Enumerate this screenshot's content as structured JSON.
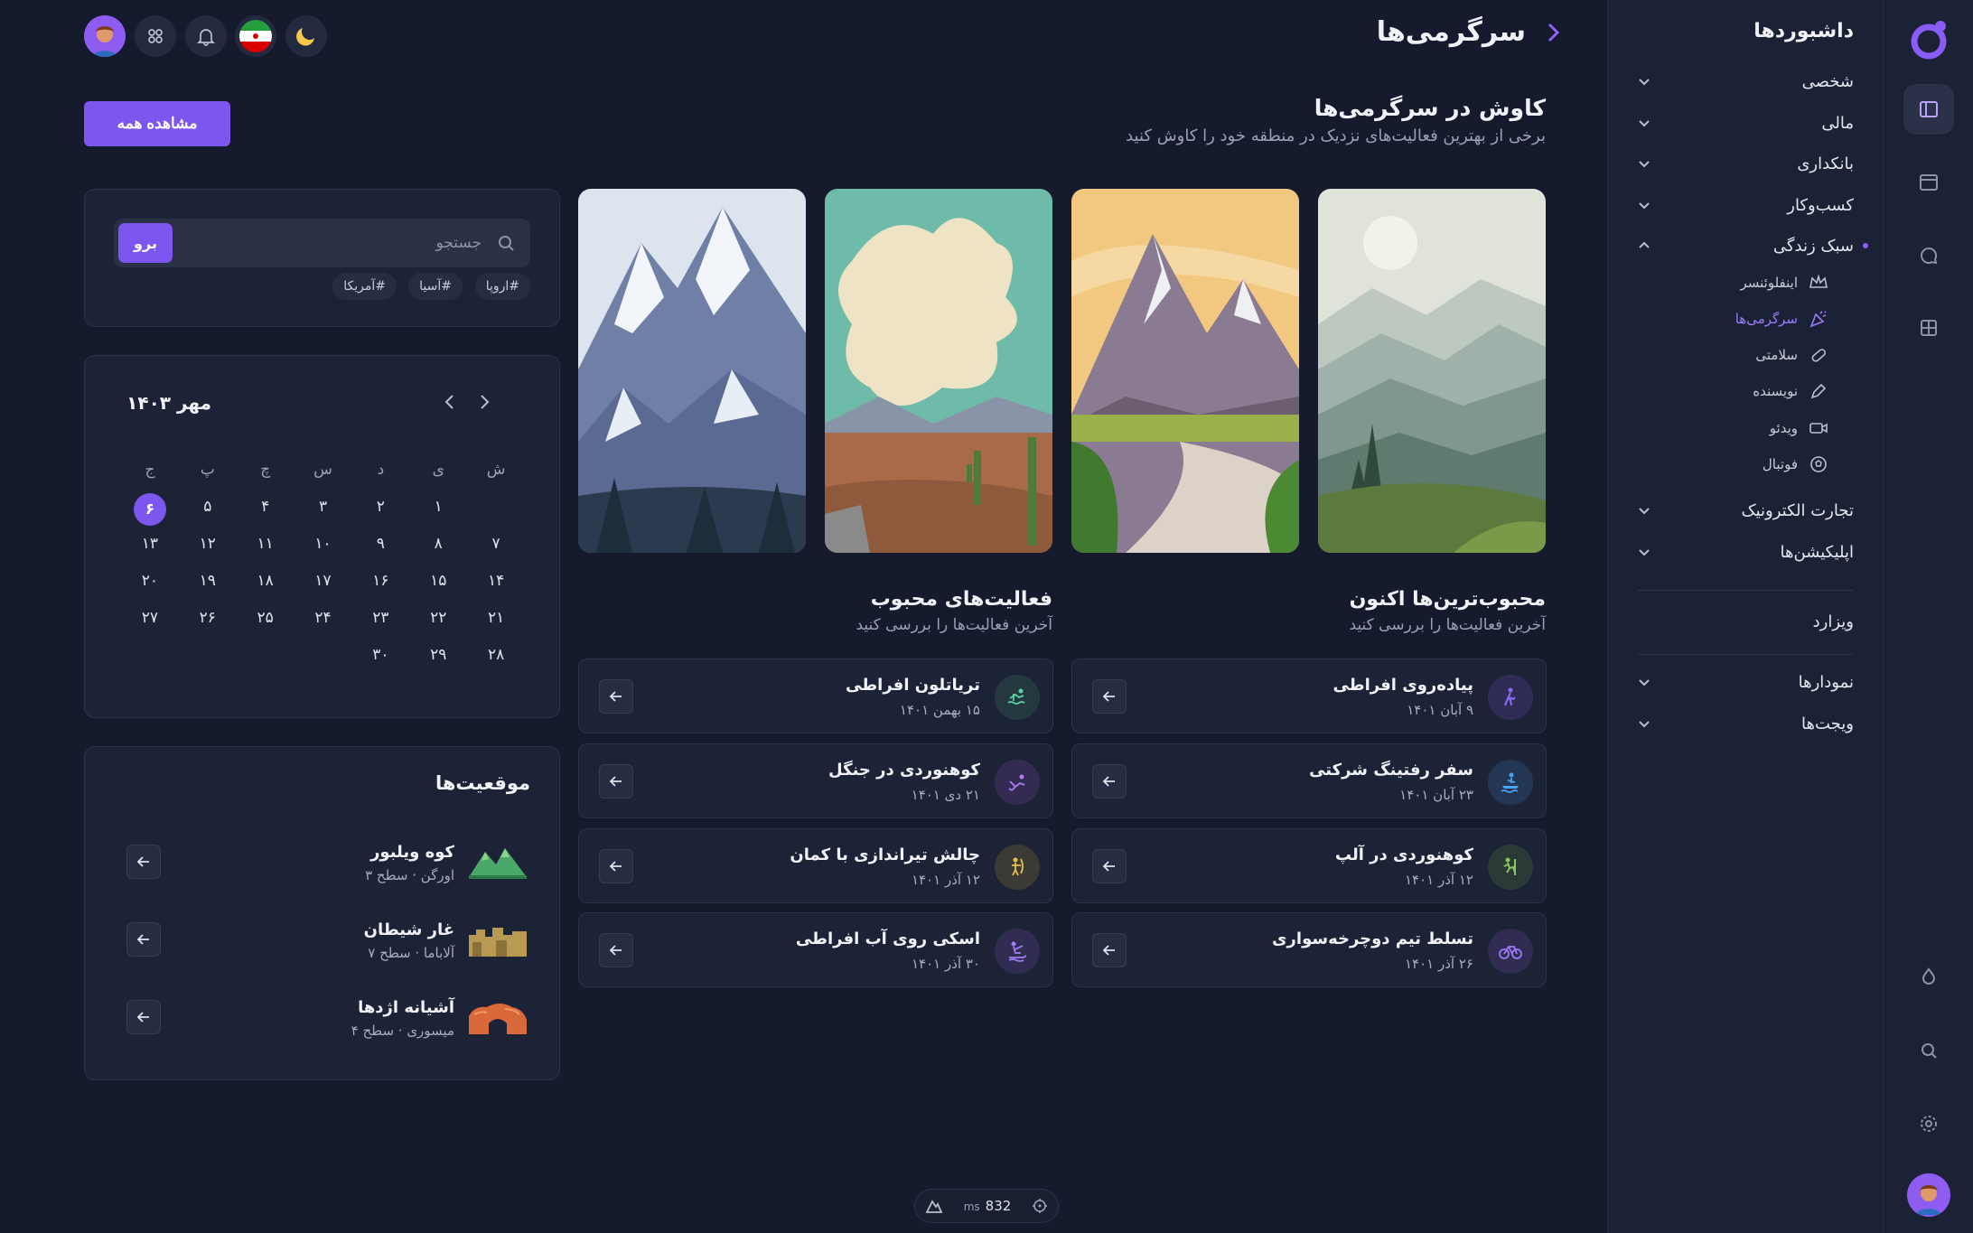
{
  "sidebar": {
    "title": "داشبوردها",
    "items": [
      {
        "label": "شخصی"
      },
      {
        "label": "مالی"
      },
      {
        "label": "بانکداری"
      },
      {
        "label": "کسب‌وکار"
      },
      {
        "label": "سبک زندگی"
      },
      {
        "label": "تجارت الکترونیک"
      },
      {
        "label": "اپلیکیشن‌ها"
      },
      {
        "label": "ویزارد"
      },
      {
        "label": "نمودارها"
      },
      {
        "label": "ویجت‌ها"
      }
    ],
    "subitems": [
      {
        "label": "اینفلوئنسر",
        "icon": "crown-icon"
      },
      {
        "label": "سرگرمی‌ها",
        "icon": "party-popper-icon",
        "active": true
      },
      {
        "label": "سلامتی",
        "icon": "pill-icon"
      },
      {
        "label": "نویسنده",
        "icon": "pen-icon"
      },
      {
        "label": "ویدئو",
        "icon": "video-icon"
      },
      {
        "label": "فوتبال",
        "icon": "football-icon"
      }
    ]
  },
  "header": {
    "title": "سرگرمی‌ها",
    "view_all": "مشاهده همه"
  },
  "explore": {
    "title": "کاوش در سرگرمی‌ها",
    "subtitle": "برخی از بهترین فعالیت‌های نزدیک در منطقه خود را کاوش کنید"
  },
  "trending": {
    "title": "محبوب‌ترین‌ها اکنون",
    "subtitle": "آخرین فعالیت‌ها را بررسی کنید",
    "items": [
      {
        "title": "پیاده‌روی افراطی",
        "date": "۹ آبان ۱۴۰۱",
        "color": "#8b6cf0",
        "bg": "#2f2d55"
      },
      {
        "title": "سفر رفتینگ شرکتی",
        "date": "۲۳ آبان ۱۴۰۱",
        "color": "#4aa3f0",
        "bg": "#233654"
      },
      {
        "title": "کوهنوردی در آلپ",
        "date": "۱۲ آذر ۱۴۰۱",
        "color": "#86c85a",
        "bg": "#2b3a36"
      },
      {
        "title": "تسلط تیم دوچرخه‌سواری",
        "date": "۲۶ آذر ۱۴۰۱",
        "color": "#9e7bf6",
        "bg": "#302c52"
      }
    ]
  },
  "popular": {
    "title": "فعالیت‌های محبوب",
    "subtitle": "آخرین فعالیت‌ها را بررسی کنید",
    "items": [
      {
        "title": "تریاتلون افراطی",
        "date": "۱۵ بهمن ۱۴۰۱",
        "color": "#5ecfa0",
        "bg": "#24393f"
      },
      {
        "title": "کوهنوردی در جنگل",
        "date": "۲۱ دی ۱۴۰۱",
        "color": "#b07af2",
        "bg": "#332b52"
      },
      {
        "title": "چالش تیراندازی با کمان",
        "date": "۱۲ آذر ۱۴۰۱",
        "color": "#e8c14a",
        "bg": "#3b3a35"
      },
      {
        "title": "اسکی روی آب افراطی",
        "date": "۳۰ آذر ۱۴۰۱",
        "color": "#a27df5",
        "bg": "#302c52"
      }
    ]
  },
  "search": {
    "placeholder": "جستجو",
    "button": "برو",
    "tags": [
      "#اروپا",
      "#آسیا",
      "#آمریکا"
    ]
  },
  "calendar": {
    "month": "مهر ۱۴۰۳",
    "weekdays": [
      "ش",
      "ی",
      "د",
      "س",
      "چ",
      "پ",
      "ج"
    ],
    "days": [
      "",
      "۱",
      "۲",
      "۳",
      "۴",
      "۵",
      "۶",
      "۷",
      "۸",
      "۹",
      "۱۰",
      "۱۱",
      "۱۲",
      "۱۳",
      "۱۴",
      "۱۵",
      "۱۶",
      "۱۷",
      "۱۸",
      "۱۹",
      "۲۰",
      "۲۱",
      "۲۲",
      "۲۳",
      "۲۴",
      "۲۵",
      "۲۶",
      "۲۷",
      "۲۸",
      "۲۹",
      "۳۰"
    ],
    "selected": "۶"
  },
  "locations": {
    "title": "موقعیت‌ها",
    "items": [
      {
        "name": "کوه ویلبور",
        "sub": "اورگن · سطح ۳"
      },
      {
        "name": "غار شیطان",
        "sub": "آلاباما · سطح ۷"
      },
      {
        "name": "آشیانه اژدها",
        "sub": "میسوری · سطح ۴"
      }
    ]
  },
  "perf": {
    "value": "832",
    "unit": "ms"
  },
  "colors": {
    "accent": "#7d55ef",
    "background": "#151a2d",
    "panel": "#1d2337"
  }
}
